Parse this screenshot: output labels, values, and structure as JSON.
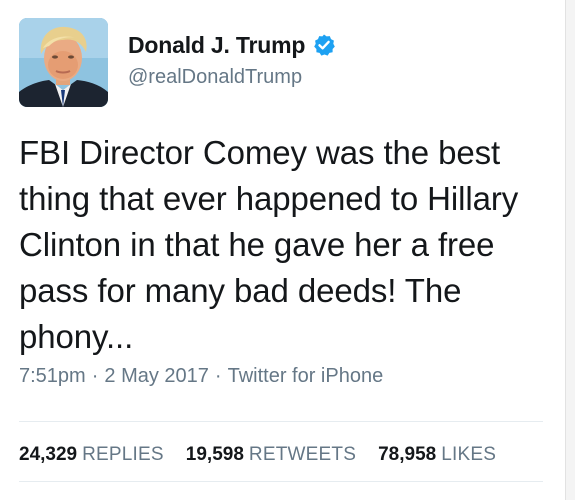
{
  "author": {
    "display_name": "Donald J. Trump",
    "handle": "@realDonaldTrump",
    "verified_icon": "verified-badge-icon",
    "avatar_icon": "profile-photo"
  },
  "tweet": {
    "text": "FBI Director Comey was the best thing that ever happened to Hillary Clinton in that he gave her a free pass for many bad deeds! The phony...",
    "time": "7:51pm",
    "date": "2 May 2017",
    "separator": "·",
    "source": "Twitter for iPhone"
  },
  "stats": {
    "replies_count": "24,329",
    "replies_label": "REPLIES",
    "retweets_count": "19,598",
    "retweets_label": "RETWEETS",
    "likes_count": "78,958",
    "likes_label": "LIKES"
  },
  "colors": {
    "text": "#14171a",
    "muted": "#657786",
    "verified": "#1da1f2",
    "divider": "#e6ecf0"
  }
}
